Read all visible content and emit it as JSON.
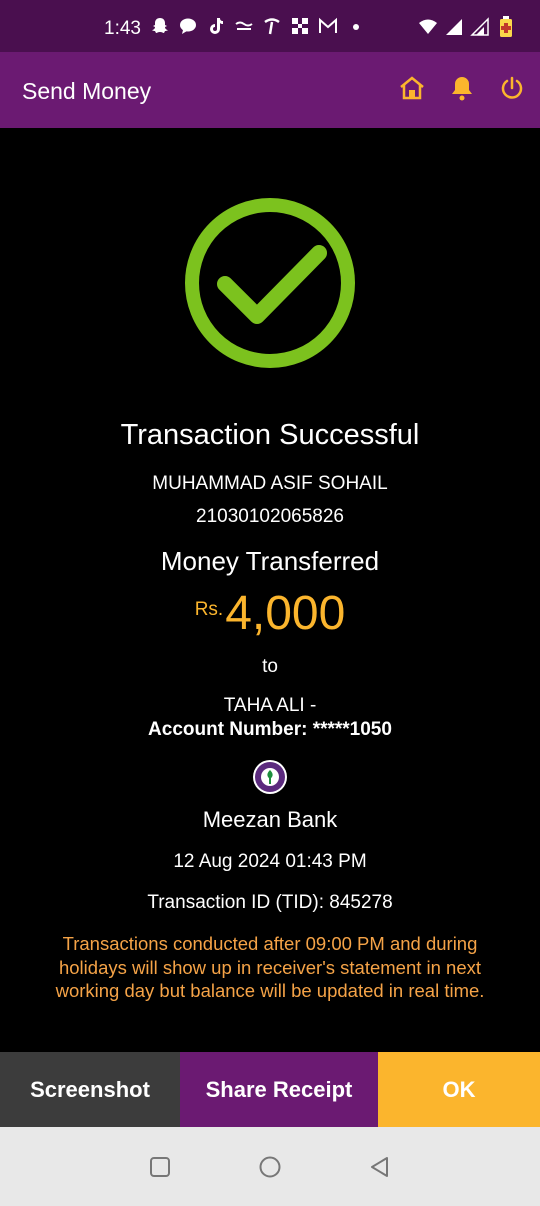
{
  "status_bar": {
    "time": "1:43",
    "icons": [
      "snapchat-icon",
      "chat-icon",
      "tiktok-icon",
      "whatsapp-business-icon",
      "phone-app-icon",
      "grid-app-icon",
      "gmail-icon",
      "dot-icon",
      "wifi-icon",
      "signal-icon",
      "signal-icon-2",
      "battery-icon"
    ]
  },
  "app_bar": {
    "title": "Send Money",
    "actions": [
      "home-icon",
      "bell-icon",
      "power-icon"
    ],
    "accent": "#fbb52d",
    "color": "#6b1a72"
  },
  "receipt": {
    "status": "Transaction Successful",
    "sender_name": "MUHAMMAD ASIF SOHAIL",
    "sender_account": "21030102065826",
    "transferred_label": "Money Transferred",
    "currency": "Rs.",
    "amount": "4,000",
    "to_label": "to",
    "receiver_name": "TAHA ALI -",
    "receiver_account": "Account Number: *****1050",
    "bank_name": "Meezan Bank",
    "bank_logo_text": "MEEZAN BANK",
    "datetime": "12 Aug 2024 01:43 PM",
    "tid": "Transaction ID (TID): 845278",
    "note": "Transactions conducted after 09:00 PM and during holidays will show up in receiver's statement in next working day but balance will be updated in real time."
  },
  "actions": {
    "screenshot": "Screenshot",
    "share": "Share Receipt",
    "ok": "OK"
  },
  "nav": [
    "recents-icon",
    "home-circle-icon",
    "back-icon"
  ]
}
